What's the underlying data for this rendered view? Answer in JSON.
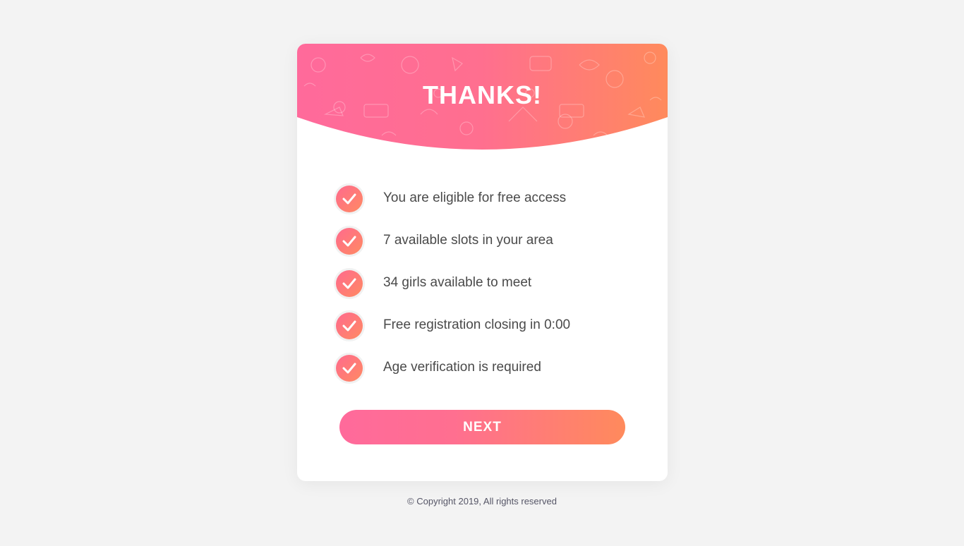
{
  "header": {
    "title": "THANKS!"
  },
  "checklist": [
    {
      "label": "You are eligible for free access"
    },
    {
      "label": "7 available slots in your area"
    },
    {
      "label": "34 girls available to meet"
    },
    {
      "label": "Free registration closing in 0:00"
    },
    {
      "label": "Age verification is required"
    }
  ],
  "next_button": {
    "label": "NEXT"
  },
  "footer": {
    "copyright": "© Copyright 2019, All rights reserved"
  },
  "colors": {
    "page_background": "#f3f3f3",
    "gradient_start": "#ff6a9b",
    "gradient_end": "#ff8a5c",
    "text": "#4a4a4a"
  },
  "icons": {
    "check": "check-icon"
  }
}
